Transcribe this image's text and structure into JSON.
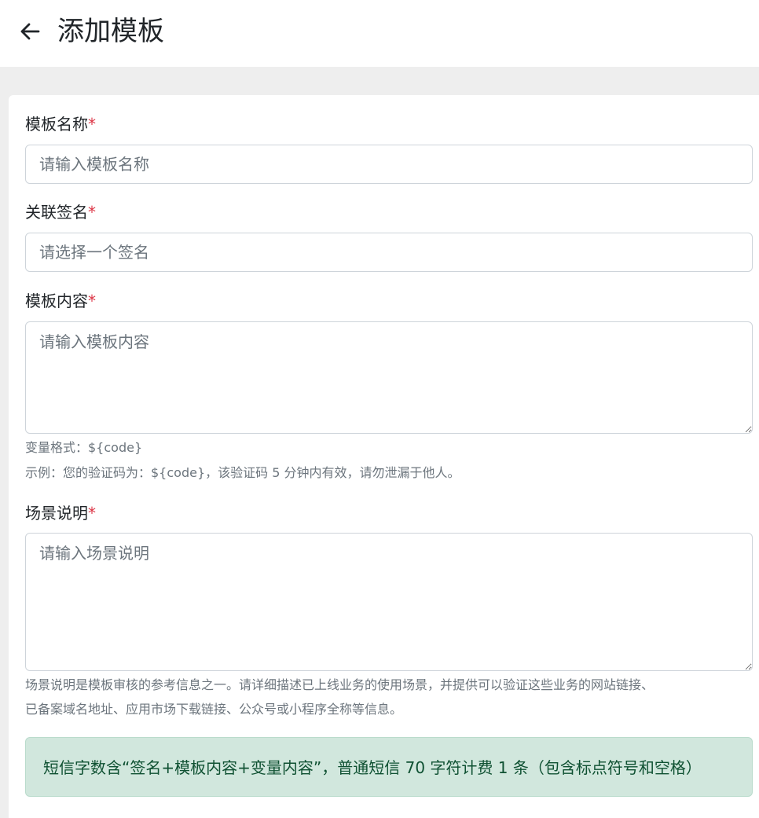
{
  "header": {
    "title": "添加模板",
    "back_icon": "arrow-left-icon"
  },
  "form": {
    "template_name": {
      "label": "模板名称",
      "required_mark": "*",
      "placeholder": "请输入模板名称",
      "value": ""
    },
    "signature": {
      "label": "关联签名",
      "required_mark": "*",
      "placeholder": "请选择一个签名",
      "value": ""
    },
    "template_content": {
      "label": "模板内容",
      "required_mark": "*",
      "placeholder": "请输入模板内容",
      "value": "",
      "help_format": "变量格式：${code}",
      "help_example": "示例：您的验证码为：${code}，该验证码 5 分钟内有效，请勿泄漏于他人。"
    },
    "scene": {
      "label": "场景说明",
      "required_mark": "*",
      "placeholder": "请输入场景说明",
      "value": "",
      "help_line1": "场景说明是模板审核的参考信息之一。请详细描述已上线业务的使用场景，并提供可以验证这些业务的网站链接、",
      "help_line2": "已备案域名地址、应用市场下载链接、公众号或小程序全称等信息。"
    },
    "notice": "短信字数含“签名+模板内容+变量内容”，普通短信 70 字符计费 1 条（包含标点符号和空格）"
  },
  "colors": {
    "required": "#dc3545",
    "alert_bg": "#d1e7dd",
    "alert_text": "#0f5132"
  }
}
